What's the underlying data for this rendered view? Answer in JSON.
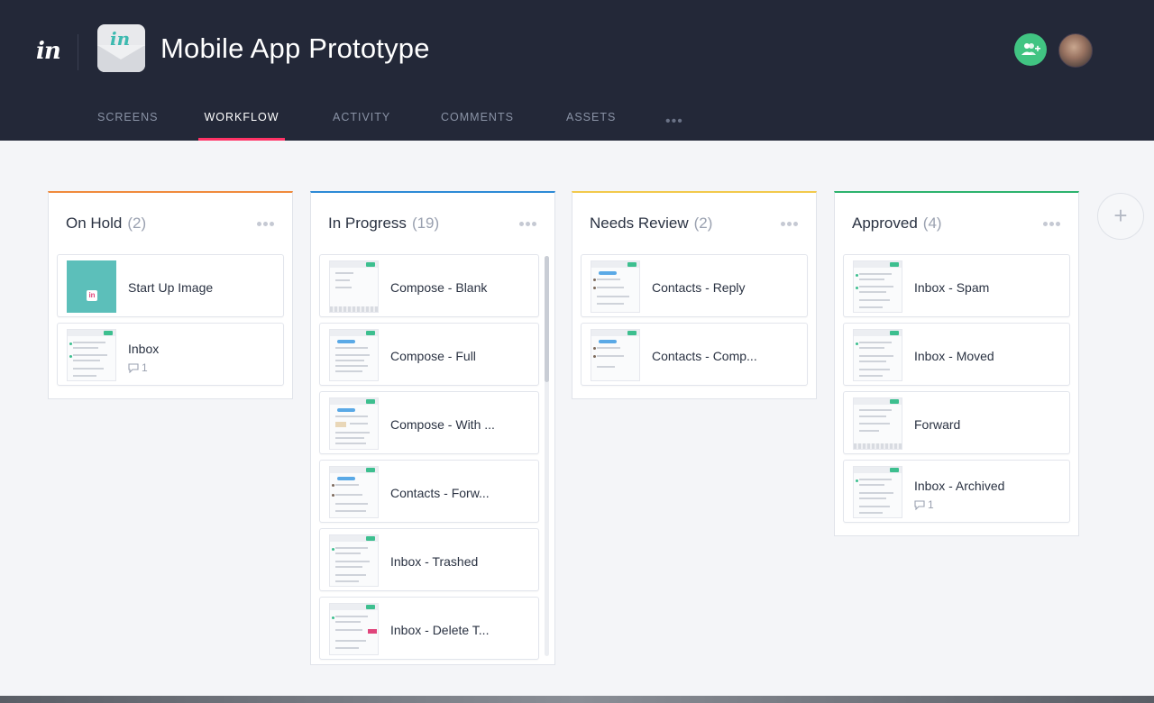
{
  "app": {
    "logo_text": "in",
    "project_icon_text": "in",
    "project_title": "Mobile App Prototype"
  },
  "tabs": [
    {
      "label": "SCREENS",
      "active": false
    },
    {
      "label": "WORKFLOW",
      "active": true
    },
    {
      "label": "ACTIVITY",
      "active": false
    },
    {
      "label": "COMMENTS",
      "active": false
    },
    {
      "label": "ASSETS",
      "active": false
    }
  ],
  "tab_more": "•••",
  "header_actions": {
    "add_user_icon": "add-user-icon",
    "avatar_icon": "user-avatar"
  },
  "colors": {
    "header_bg": "#232838",
    "accent_tab": "#ff3366",
    "on_hold": "#f08a3c",
    "in_progress": "#2d8ad6",
    "needs_review": "#f2c94c",
    "approved": "#2db36e",
    "add_user_btn": "#41c482"
  },
  "columns": [
    {
      "name": "On Hold",
      "count": "(2)",
      "cards": [
        {
          "title": "Start Up Image",
          "thumb": "splash"
        },
        {
          "title": "Inbox",
          "comments": "1",
          "thumb": "inbox"
        }
      ]
    },
    {
      "name": "In Progress",
      "count": "(19)",
      "cards": [
        {
          "title": "Compose - Blank",
          "thumb": "compose"
        },
        {
          "title": "Compose - Full",
          "thumb": "compose-full"
        },
        {
          "title": "Compose - With ...",
          "thumb": "compose-full"
        },
        {
          "title": "Contacts - Forw...",
          "thumb": "contacts"
        },
        {
          "title": "Inbox - Trashed",
          "thumb": "inbox"
        },
        {
          "title": "Inbox - Delete T...",
          "thumb": "inbox"
        }
      ]
    },
    {
      "name": "Needs Review",
      "count": "(2)",
      "cards": [
        {
          "title": "Contacts - Reply",
          "thumb": "contacts"
        },
        {
          "title": "Contacts - Comp...",
          "thumb": "contacts"
        }
      ]
    },
    {
      "name": "Approved",
      "count": "(4)",
      "cards": [
        {
          "title": "Inbox - Spam",
          "thumb": "inbox"
        },
        {
          "title": "Inbox - Moved",
          "thumb": "inbox"
        },
        {
          "title": "Forward",
          "thumb": "compose-full"
        },
        {
          "title": "Inbox - Archived",
          "comments": "1",
          "thumb": "inbox"
        }
      ]
    }
  ],
  "add_column_symbol": "+"
}
